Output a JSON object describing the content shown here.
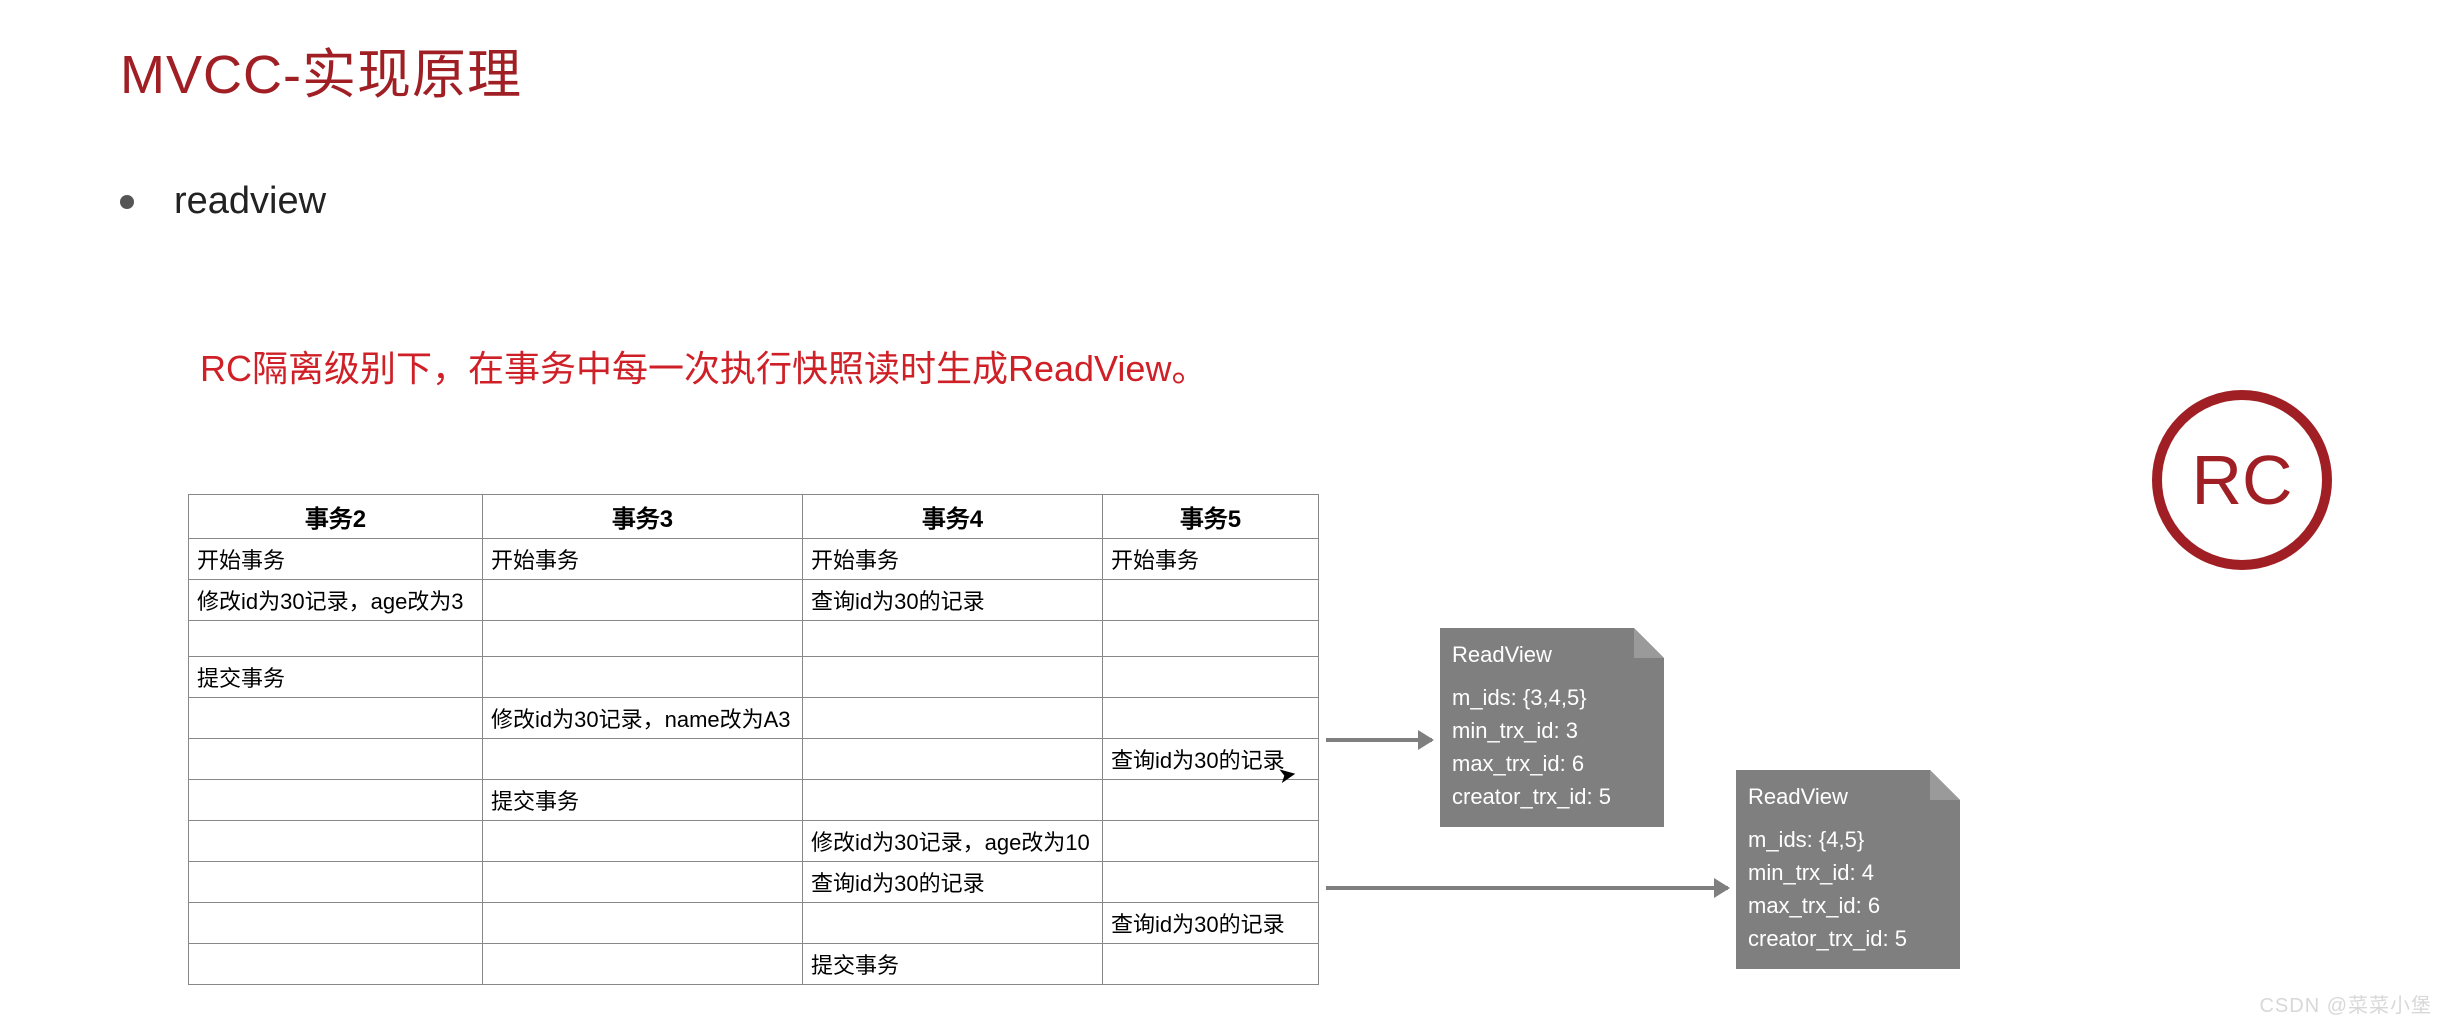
{
  "title": "MVCC-实现原理",
  "bullet": "readview",
  "subhead": "RC隔离级别下，在事务中每一次执行快照读时生成ReadView。",
  "rc_label": "RC",
  "watermark": "CSDN @菜菜小堡",
  "table": {
    "headers": [
      "事务2",
      "事务3",
      "事务4",
      "事务5"
    ],
    "rows": [
      [
        "开始事务",
        "开始事务",
        "开始事务",
        "开始事务"
      ],
      [
        "修改id为30记录，age改为3",
        "",
        "查询id为30的记录",
        ""
      ],
      [
        "",
        "",
        "",
        ""
      ],
      [
        "提交事务",
        "",
        "",
        ""
      ],
      [
        "",
        "修改id为30记录，name改为A3",
        "",
        ""
      ],
      [
        "",
        "",
        "",
        "查询id为30的记录"
      ],
      [
        "",
        "提交事务",
        "",
        ""
      ],
      [
        "",
        "",
        "修改id为30记录，age改为10",
        ""
      ],
      [
        "",
        "",
        "查询id为30的记录",
        ""
      ],
      [
        "",
        "",
        "",
        "查询id为30的记录"
      ],
      [
        "",
        "",
        "提交事务",
        ""
      ]
    ]
  },
  "readview1": {
    "title": "ReadView",
    "m_ids": "m_ids: {3,4,5}",
    "min": "min_trx_id: 3",
    "max": "max_trx_id: 6",
    "creator": "creator_trx_id: 5"
  },
  "readview2": {
    "title": "ReadView",
    "m_ids": "m_ids: {4,5}",
    "min": "min_trx_id: 4",
    "max": "max_trx_id: 6",
    "creator": "creator_trx_id: 5"
  }
}
